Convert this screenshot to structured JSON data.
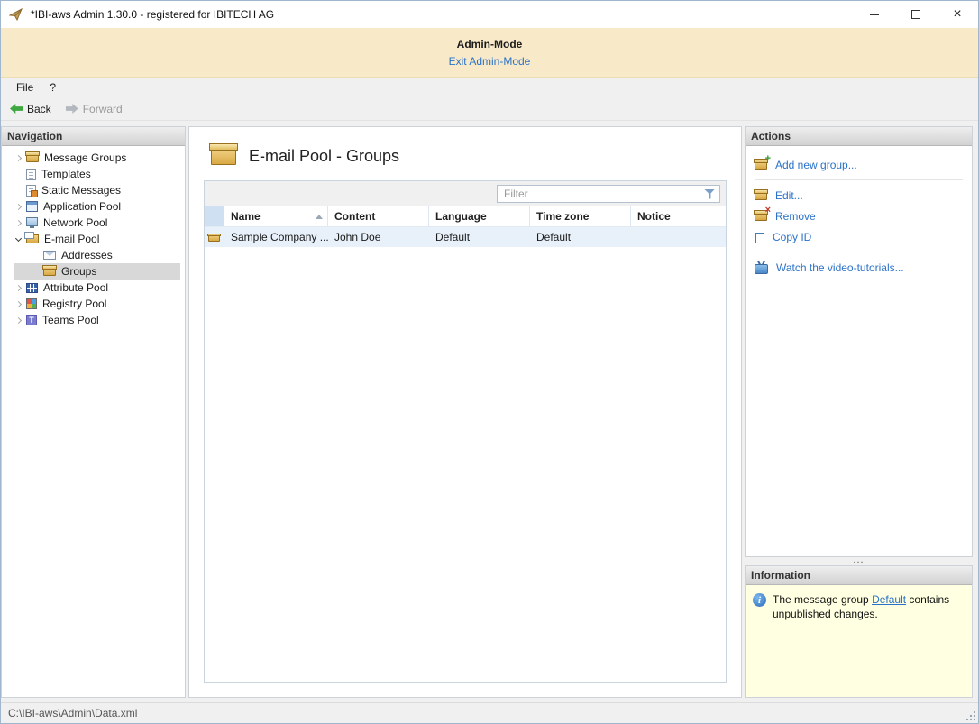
{
  "window": {
    "title": "*IBI-aws Admin 1.30.0 - registered for IBITECH AG",
    "close_glyph": "×"
  },
  "admin_banner": {
    "title": "Admin-Mode",
    "exit_link": "Exit Admin-Mode"
  },
  "menu": {
    "items": [
      {
        "label": "File"
      },
      {
        "label": "?"
      }
    ]
  },
  "toolbar": {
    "back_label": "Back",
    "forward_label": "Forward"
  },
  "navigation": {
    "header": "Navigation",
    "items": [
      {
        "label": "Message Groups",
        "state": "collapsed"
      },
      {
        "label": "Templates",
        "state": "leaf"
      },
      {
        "label": "Static Messages",
        "state": "leaf"
      },
      {
        "label": "Application Pool",
        "state": "collapsed"
      },
      {
        "label": "Network Pool",
        "state": "collapsed"
      },
      {
        "label": "E-mail Pool",
        "state": "expanded"
      },
      {
        "label": "Addresses",
        "state": "leaf-child"
      },
      {
        "label": "Groups",
        "state": "leaf-child-selected"
      },
      {
        "label": "Attribute Pool",
        "state": "collapsed"
      },
      {
        "label": "Registry Pool",
        "state": "collapsed"
      },
      {
        "label": "Teams Pool",
        "state": "collapsed"
      }
    ]
  },
  "main": {
    "title": "E-mail Pool - Groups",
    "filter_placeholder": "Filter",
    "table": {
      "columns": [
        "Name",
        "Content",
        "Language",
        "Time zone",
        "Notice"
      ],
      "sort_column": "Name",
      "sort_direction": "ascending",
      "rows": [
        {
          "name": "Sample Company ...",
          "content": "John Doe",
          "language": "Default",
          "time_zone": "Default",
          "notice": ""
        }
      ]
    }
  },
  "actions": {
    "header": "Actions",
    "items": [
      "Add new group...",
      "Edit...",
      "Remove",
      "Copy ID",
      "Watch the video-tutorials..."
    ]
  },
  "splitter_grip": "...",
  "information": {
    "header": "Information",
    "text_before": "The message group ",
    "link": "Default",
    "text_after": " contains unpublished changes."
  },
  "status_bar": {
    "path": "C:\\IBI-aws\\Admin\\Data.xml"
  },
  "icons": {
    "app": "paper-plane-logo",
    "back": "green-left-arrow",
    "forward": "gray-right-arrow",
    "filter": "funnel",
    "info": "blue-info-circle",
    "group": "gold-open-box"
  },
  "colors": {
    "banner_bg": "#f8e9c9",
    "link_blue": "#2a72c8",
    "info_bg": "#ffffe1",
    "row_highlight": "#e8f1fa",
    "selection_gray": "#d8d8d8"
  }
}
